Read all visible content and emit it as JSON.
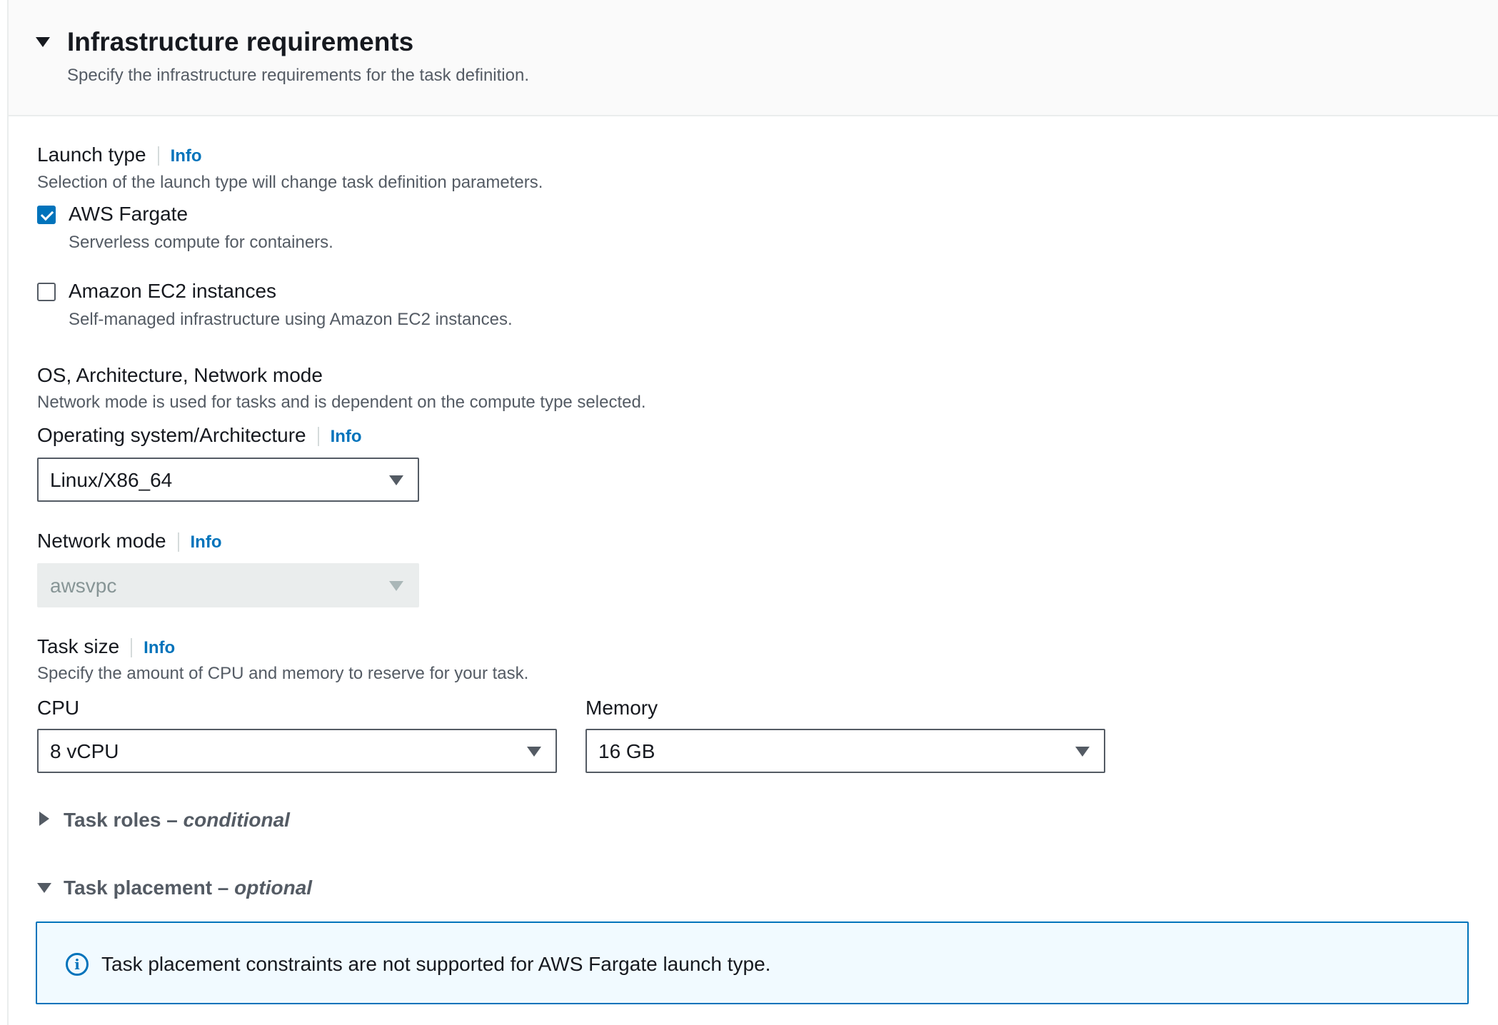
{
  "header": {
    "title": "Infrastructure requirements",
    "description": "Specify the infrastructure requirements for the task definition."
  },
  "launch_type": {
    "label": "Launch type",
    "info": "Info",
    "description": "Selection of the launch type will change task definition parameters.",
    "options": [
      {
        "label": "AWS Fargate",
        "description": "Serverless compute for containers.",
        "checked": true
      },
      {
        "label": "Amazon EC2 instances",
        "description": "Self-managed infrastructure using Amazon EC2 instances.",
        "checked": false
      }
    ]
  },
  "os_arch_network": {
    "label": "OS, Architecture, Network mode",
    "description": "Network mode is used for tasks and is dependent on the compute type selected."
  },
  "os_arch": {
    "label": "Operating system/Architecture",
    "info": "Info",
    "value": "Linux/X86_64"
  },
  "network_mode": {
    "label": "Network mode",
    "info": "Info",
    "value": "awsvpc"
  },
  "task_size": {
    "label": "Task size",
    "info": "Info",
    "description": "Specify the amount of CPU and memory to reserve for your task.",
    "cpu_label": "CPU",
    "cpu_value": "8 vCPU",
    "memory_label": "Memory",
    "memory_value": "16 GB"
  },
  "task_roles": {
    "title": "Task roles",
    "separator": " – ",
    "qualifier": "conditional"
  },
  "task_placement": {
    "title": "Task placement",
    "separator": " – ",
    "qualifier": "optional",
    "alert_icon": "i",
    "alert_text": "Task placement constraints are not supported for AWS Fargate launch type."
  },
  "colors": {
    "link": "#0073bb",
    "text": "#16191f",
    "secondary": "#545b64"
  }
}
